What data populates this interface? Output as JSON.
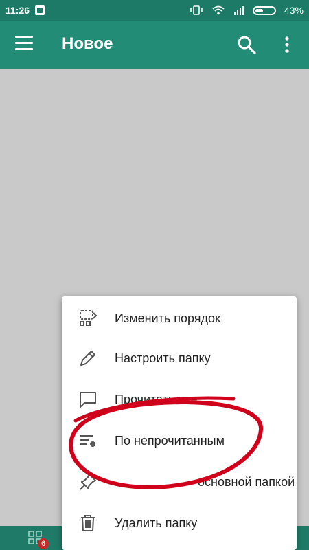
{
  "status_bar": {
    "time": "11:26",
    "battery": "43%"
  },
  "app_bar": {
    "title": "Новое"
  },
  "bottom_bar": {
    "badge_count": "6"
  },
  "menu": {
    "items": [
      {
        "label": "Изменить порядок",
        "icon": "reorder-icon"
      },
      {
        "label": "Настроить папку",
        "icon": "pencil-icon"
      },
      {
        "label": "Прочитать все",
        "icon": "chat-bubble-icon"
      },
      {
        "label": "По непрочитанным",
        "icon": "filter-unread-icon"
      },
      {
        "label": "основной папкой",
        "icon": "pin-icon"
      },
      {
        "label": "Удалить папку",
        "icon": "trash-icon"
      }
    ]
  },
  "colors": {
    "accent": "#238c76",
    "status": "#1c7a67",
    "annotation": "#d0021b"
  }
}
